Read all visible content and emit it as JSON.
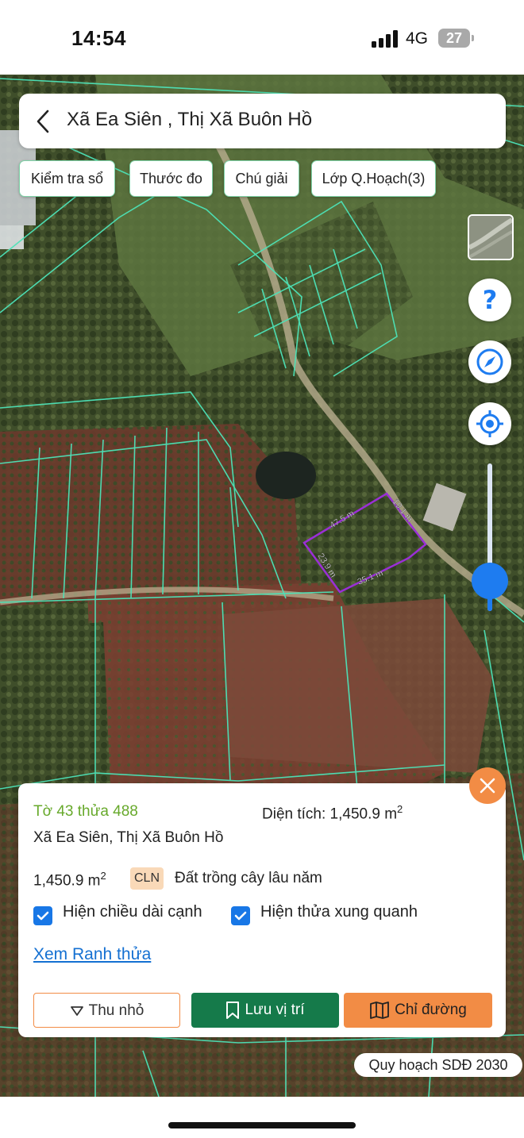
{
  "status_bar": {
    "time": "14:54",
    "network": "4G",
    "battery": "27"
  },
  "header": {
    "title": "Xã Ea Siên , Thị Xã Buôn Hồ"
  },
  "chips": [
    {
      "label": "Kiểm tra sổ"
    },
    {
      "label": "Thước đo"
    },
    {
      "label": "Chú giải"
    },
    {
      "label": "Lớp Q.Hoạch(3)"
    }
  ],
  "map": {
    "parcel_edges": {
      "top": "47.5 m",
      "right": "19.1 m",
      "bottom": "35.1 m",
      "left": "23.9 m"
    },
    "parcel_outline_color": "#9a2fd6",
    "boundary_color": "#4de3b8",
    "zoom_level": 0.2,
    "plan_badge": "Quy hoạch SDĐ 2030"
  },
  "card": {
    "parcel_id": "Tờ 43 thửa 488",
    "area_label": "Diện tích: 1,450.9 m",
    "area_sup": "2",
    "address": "Xã Ea Siên, Thị Xã Buôn Hồ",
    "area_value": "1,450.9 m",
    "area_value_sup": "2",
    "land_code": "CLN",
    "land_type": "Đất trồng cây lâu năm",
    "check_edge_length": "Hiện chiều dài cạnh",
    "check_surrounding": "Hiện thửa xung quanh",
    "link_boundary": "Xem Ranh thửa",
    "btn_shrink": "Thu nhỏ",
    "btn_save": "Lưu vị trí",
    "btn_route": "Chỉ đường",
    "accent_color": "#f28c45",
    "primary_color": "#157a4a"
  }
}
